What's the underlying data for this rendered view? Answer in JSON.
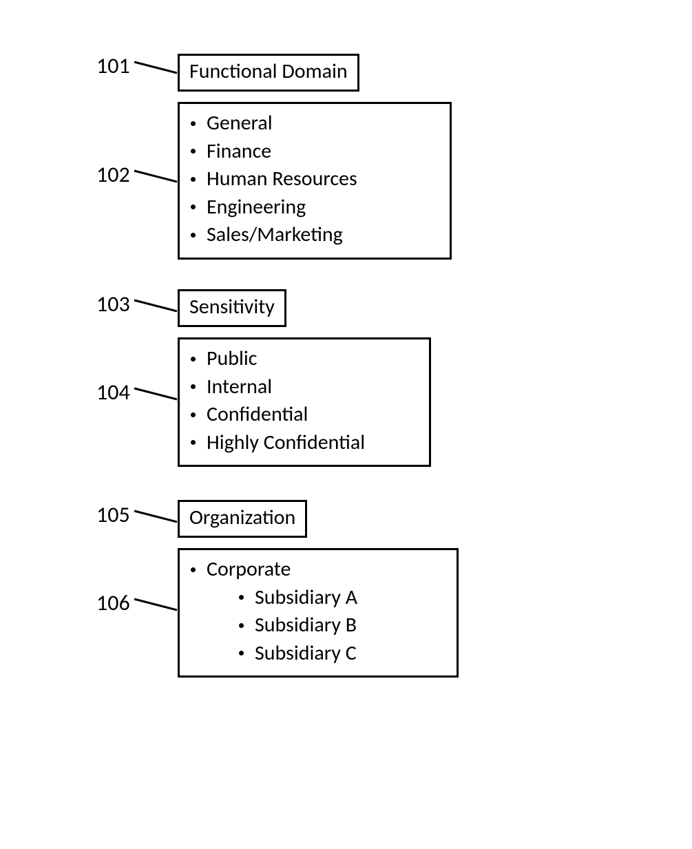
{
  "sections": {
    "functional_domain": {
      "ref": "101",
      "title": "Functional Domain",
      "list_ref": "102",
      "items": [
        "General",
        "Finance",
        "Human Resources",
        "Engineering",
        "Sales/Marketing"
      ]
    },
    "sensitivity": {
      "ref": "103",
      "title": "Sensitivity",
      "list_ref": "104",
      "items": [
        "Public",
        "Internal",
        "Confidential",
        "Highly Confidential"
      ]
    },
    "organization": {
      "ref": "105",
      "title": "Organization",
      "list_ref": "106",
      "top_item": "Corporate",
      "sub_items": [
        "Subsidiary A",
        "Subsidiary B",
        "Subsidiary C"
      ]
    }
  }
}
